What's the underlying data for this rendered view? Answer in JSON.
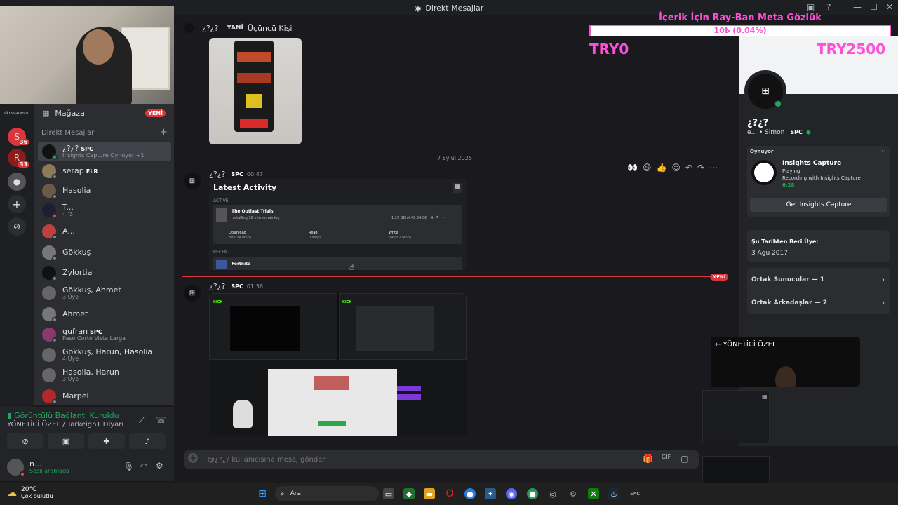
{
  "window": {
    "title": "Direkt Mesajlar"
  },
  "overlay": {
    "title": "İçerik İçin Ray-Ban Meta Gözlük",
    "progress_text": "10₺ (0.04%)",
    "progress_fraction": 0.0004,
    "left_amount": "TRY0",
    "right_amount": "TRY2500"
  },
  "rail": {
    "brand_text": "skcssarwsu",
    "badge1": "36",
    "badge2": "33"
  },
  "sidebar": {
    "store_label": "Mağaza",
    "store_badge": "YENİ",
    "dm_header": "Direkt Mesajlar",
    "dms": [
      {
        "name": "¿?¿?",
        "tag": "SPC",
        "sub": "Insights Capture Oynuyor +1",
        "active": true
      },
      {
        "name": "serap",
        "tag": "ELR",
        "sub": ""
      },
      {
        "name": "Hasolia",
        "tag": "",
        "sub": ""
      },
      {
        "name": "T...",
        "tag": "",
        "sub": "·.:'3"
      },
      {
        "name": "A...",
        "tag": "",
        "sub": ""
      },
      {
        "name": "Gökkuş",
        "tag": "",
        "sub": ""
      },
      {
        "name": "Zylortia",
        "tag": "",
        "sub": ""
      },
      {
        "name": "Gökkuş, Ahmet",
        "tag": "",
        "sub": "3 Üye"
      },
      {
        "name": "Ahmet",
        "tag": "",
        "sub": ""
      },
      {
        "name": "gufran",
        "tag": "SPC",
        "sub": "Paso Corto Vista Larga"
      },
      {
        "name": "Gökkuş, Harun, Hasolia",
        "tag": "",
        "sub": "4 Üye"
      },
      {
        "name": "Hasolia, Harun",
        "tag": "",
        "sub": "3 Üye"
      },
      {
        "name": "Marpel",
        "tag": "",
        "sub": ""
      }
    ]
  },
  "voice": {
    "status": "Görüntülü Bağlantı Kuruldu",
    "channel": "YÖNETİCİ ÖZEL / TarkeighT Diyarı",
    "user_name": "n...",
    "user_status": "Sesli aramada"
  },
  "chat": {
    "header_name": "¿?¿?",
    "header_tab1": "YANİ",
    "header_tab2": "Üçüncü Kişi",
    "date_separator": "7 Eylül 2025",
    "new_label": "YENİ",
    "msg1": {
      "author": "¿?¿?",
      "tag": "SPC",
      "time": "00:47"
    },
    "msg2": {
      "author": "¿?¿?",
      "tag": "SPC",
      "time": "01:36"
    },
    "activity": {
      "title": "Latest Activity",
      "active_label": "ACTIVE",
      "game": "The Outlast Trials",
      "game_status": "Installing 18 min remaining",
      "game_size": "1.29 GB of 48.64 GB",
      "download_label": "Download",
      "download_value": "808.34 Mbps",
      "read_label": "Read",
      "read_value": "0 Mbps",
      "write_label": "Write",
      "write_value": "640.82 Mbps",
      "recent_label": "RECENT",
      "recent_game": "Fortnite"
    },
    "composer_placeholder": "@¿?¿? kullanıcısına mesaj gönder"
  },
  "profile": {
    "name": "¿?¿?",
    "sub": "e... • Simon",
    "tag": "SPC",
    "playing_header": "Oynuyor",
    "game_name": "Insights Capture",
    "game_state": "Playing",
    "game_detail": "Recording with Insights Capture",
    "game_time": "6:28",
    "get_button": "Get Insights Capture",
    "member_since_label": "Şu Tarihten Beri Üye:",
    "member_since": "3 Ağu 2017",
    "mutual_servers": "Ortak Sunucular — 1",
    "mutual_friends": "Ortak Arkadaşlar — 2",
    "video_label": "← YÖNETİCİ ÖZEL"
  },
  "taskbar": {
    "weather_temp": "20°C",
    "weather_text": "Çok bulutlu",
    "search_placeholder": "Ara"
  }
}
